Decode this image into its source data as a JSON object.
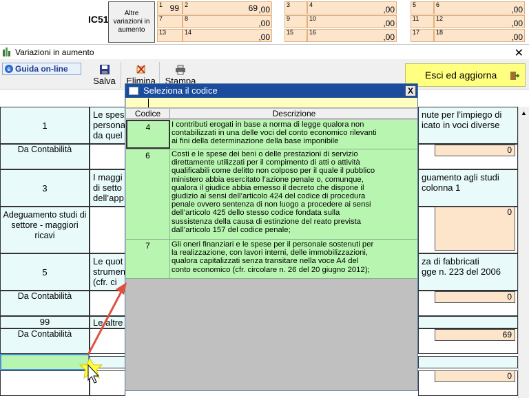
{
  "top": {
    "section_code": "IC51",
    "box_label": "Altre variazioni in aumento",
    "cells": [
      {
        "num": "1",
        "sub": "99",
        "val": "",
        "dec": ""
      },
      {
        "num": "2",
        "val": "69",
        "dec": ",00"
      },
      {
        "num": "3",
        "val": "",
        "dec": ",00"
      },
      {
        "num": "4",
        "val": "",
        "dec": ",00"
      },
      {
        "num": "5",
        "val": "",
        "dec": ",00"
      },
      {
        "num": "6",
        "val": "",
        "dec": ",00"
      },
      {
        "num": "7",
        "val": "",
        "dec": ""
      },
      {
        "num": "8",
        "val": "",
        "dec": ",00"
      },
      {
        "num": "9",
        "val": "",
        "dec": ",00"
      },
      {
        "num": "10",
        "val": "",
        "dec": ",00"
      },
      {
        "num": "11",
        "val": "",
        "dec": ",00"
      },
      {
        "num": "12",
        "val": "",
        "dec": ",00"
      },
      {
        "num": "13",
        "val": "",
        "dec": ""
      },
      {
        "num": "14",
        "val": "",
        "dec": ",00"
      },
      {
        "num": "15",
        "val": "",
        "dec": ",00"
      },
      {
        "num": "16",
        "val": "",
        "dec": ",00"
      },
      {
        "num": "17",
        "val": "",
        "dec": ",00"
      },
      {
        "num": "18",
        "val": "",
        "dec": ",00"
      }
    ]
  },
  "window": {
    "title": "Variazioni in aumento",
    "close": "X"
  },
  "toolbar": {
    "guida": "Guida on-line",
    "salva": "Salva",
    "elimina": "Elimina",
    "stampa": "Stampa",
    "esci": "Esci ed aggiorna"
  },
  "form": {
    "row1": {
      "code": "1",
      "desc_left": "Le spes",
      "desc_left2": "persona",
      "desc_left3": "da quel",
      "desc_right": "nute per l’impiego di",
      "desc_right2": "icato in voci diverse",
      "label": "Da Contabilità",
      "amount": "0"
    },
    "row3": {
      "code": "3",
      "desc_left": "I maggi",
      "desc_left2": "di setto",
      "desc_left3": "dell’app",
      "desc_right": "guamento agli studi",
      "desc_right2": "colonna 1",
      "label": "Adeguamento studi di settore - maggiori ricavi",
      "amount": "0"
    },
    "row5": {
      "code": "5",
      "desc_left": "Le quot",
      "desc_left2": "strumen",
      "desc_left3": "(cfr. ci",
      "desc_right": "za di fabbricati",
      "desc_right2": "gge n. 223 del 2006",
      "label": "Da Contabilità",
      "amount": "0"
    },
    "row99": {
      "code": "99",
      "desc_left": "Le altre",
      "label": "Da Contabilità",
      "amount": "69"
    },
    "last_amount": "0"
  },
  "dialog": {
    "title": "Seleziona il codice",
    "close": "X",
    "col_code": "Codice",
    "col_desc": "Descrizione",
    "rows": [
      {
        "code": "4",
        "lines": [
          "I contributi erogati in base a norma di legge qualora non",
          "contabilizzati in una delle voci del conto economico rilevanti",
          "ai fini della determinazione della base imponibile"
        ]
      },
      {
        "code": "6",
        "lines": [
          "Costi e le spese dei beni o delle prestazioni di servizio",
          "direttamente utilizzati per il compimento di atti o attività",
          "qualificabili come delitto non colposo per il quale il pubblico",
          "ministero abbia esercitato l’azione penale o, comunque,",
          "qualora il giudice abbia emesso il decreto che dispone il",
          "giudizio ai sensi dell’articolo 424 del codice di procedura",
          "penale ovvero sentenza di non luogo a procedere ai sensi",
          "dell’articolo 425 dello stesso codice fondata sulla",
          "sussistenza della causa di estinzione del reato prevista",
          "dall’articolo 157 del codice penale;"
        ]
      },
      {
        "code": "7",
        "lines": [
          "Gli oneri finanziari e le spese per il personale sostenuti per",
          "la realizzazione, con lavori interni, delle immobilizzazioni,",
          "qualora capitalizzati senza transitare nella voce A4 del",
          "conto economico (cfr. circolare n. 26 del 20 giugno 2012);"
        ]
      }
    ]
  },
  "colors": {
    "dialog_title": "#1a4b9c",
    "row_green": "#b8f5b0",
    "peach": "#fde5cc",
    "cyan": "#e8fafa",
    "arrow": "#e05040"
  }
}
